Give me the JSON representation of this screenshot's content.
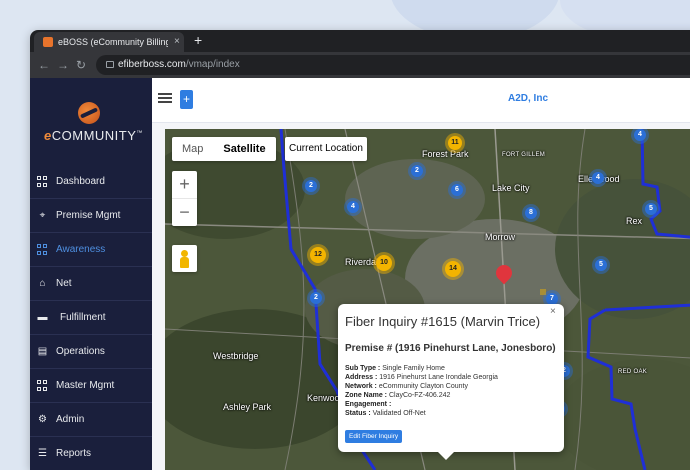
{
  "browser": {
    "tab_title": "eBOSS (eCommunity Billing & C",
    "tab_close": "×",
    "new_tab": "+",
    "url_host": "efiberboss.com",
    "url_path": "/vmap/index"
  },
  "brand": {
    "logo_e": "e",
    "logo_text": "COMMUNITY",
    "logo_tm": "™",
    "accent_color": "#f08a3a"
  },
  "sidebar": {
    "items": [
      {
        "label": "Dashboard",
        "icon": "grid-icon",
        "active": false
      },
      {
        "label": "Premise Mgmt",
        "icon": "map-pin-icon",
        "active": false
      },
      {
        "label": "Awareness",
        "icon": "grid-icon",
        "active": true
      },
      {
        "label": "Net",
        "icon": "dome-icon",
        "active": false
      },
      {
        "label": "Fulfillment",
        "icon": "truck-icon",
        "active": false
      },
      {
        "label": "Operations",
        "icon": "card-icon",
        "active": false
      },
      {
        "label": "Master Mgmt",
        "icon": "grid-icon",
        "active": false
      },
      {
        "label": "Admin",
        "icon": "user-gear-icon",
        "active": false
      },
      {
        "label": "Reports",
        "icon": "list-icon",
        "active": false
      }
    ]
  },
  "header": {
    "add_label": "+",
    "org_name": "A2D, Inc"
  },
  "map": {
    "type_map": "Map",
    "type_satellite": "Satellite",
    "selected_type": "Satellite",
    "current_location": "Current Location",
    "zoom_in": "+",
    "zoom_out": "−",
    "places": [
      "Forest Park",
      "FORT GILLEM",
      "Lake City",
      "Ellenwood",
      "Rex",
      "Morrow",
      "Riverdale",
      "Westbridge",
      "Ashley Park",
      "Kenwoo",
      "RED OAK"
    ],
    "clusters": [
      "11",
      "2",
      "4",
      "2",
      "6",
      "8",
      "4",
      "5",
      "4",
      "12",
      "10",
      "14",
      "5",
      "2",
      "7",
      "2",
      "4"
    ],
    "cluster_colors": {
      "small": "#2b6fd6",
      "large": "#f3b400"
    }
  },
  "popup": {
    "close": "×",
    "title": "Fiber Inquiry #1615 (Marvin Trice)",
    "premise": "Premise # (1916 Pinehurst Lane, Jonesboro)",
    "fields": [
      {
        "label": "Sub Type :",
        "value": " Single Family Home"
      },
      {
        "label": "Address :",
        "value": " 1916 Pinehurst Lane Irondale Georgia"
      },
      {
        "label": "Network :",
        "value": " eCommunity Clayton County"
      },
      {
        "label": "Zone Name :",
        "value": " ClayCo-FZ-406.242"
      },
      {
        "label": "Engagement :",
        "value": ""
      },
      {
        "label": "Status :",
        "value": " Validated Off-Net"
      }
    ],
    "button_label": "Edit Fiber Inquiry"
  }
}
